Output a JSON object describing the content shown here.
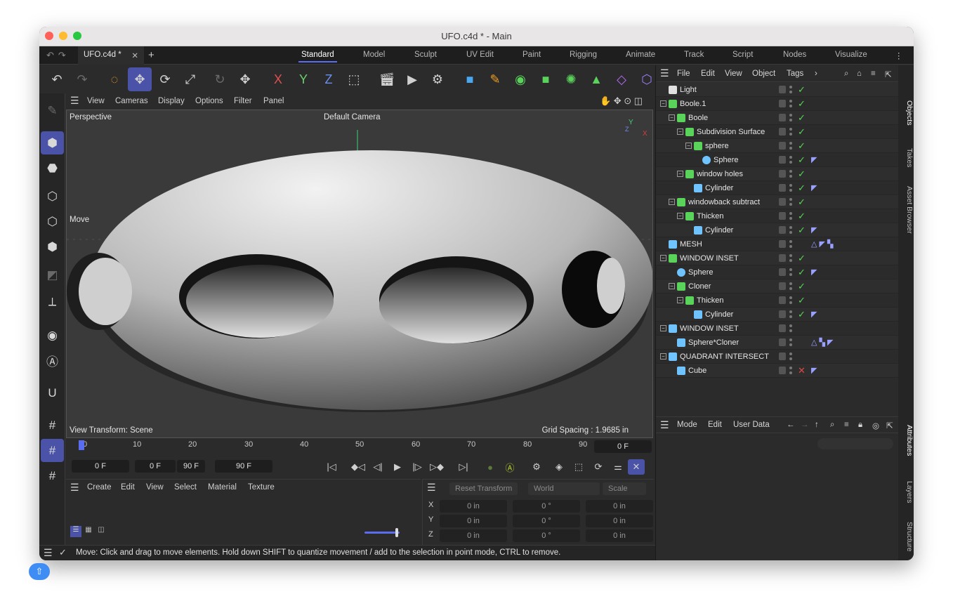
{
  "window": {
    "title": "UFO.c4d * - Main"
  },
  "doc_tab": {
    "label": "UFO.c4d *"
  },
  "layouts": [
    "Standard",
    "Model",
    "Sculpt",
    "UV Edit",
    "Paint",
    "Rigging",
    "Animate",
    "Track",
    "Script",
    "Nodes",
    "Visualize"
  ],
  "axes": {
    "x": "X",
    "y": "Y",
    "z": "Z"
  },
  "viewport_menu": [
    "View",
    "Cameras",
    "Display",
    "Options",
    "Filter",
    "Panel"
  ],
  "viewport": {
    "name": "Perspective",
    "camera": "Default Camera",
    "tool": "Move",
    "view_transform": "View Transform: Scene",
    "grid_spacing": "Grid Spacing : 1.9685 in"
  },
  "timeline": {
    "ticks": [
      "0",
      "10",
      "20",
      "30",
      "40",
      "50",
      "60",
      "70",
      "80",
      "90"
    ],
    "current_frame": "0 F",
    "start": "0 F",
    "min": "0 F",
    "max": "90 F",
    "end": "90 F"
  },
  "material_menu": [
    "Create",
    "Edit",
    "View",
    "Select",
    "Material",
    "Texture"
  ],
  "coords": {
    "reset": "Reset Transform",
    "space": "World",
    "mode": "Scale",
    "rows": [
      {
        "axis": "X",
        "pos": "0 in",
        "rot": "0 °",
        "scale": "0 in"
      },
      {
        "axis": "Y",
        "pos": "0 in",
        "rot": "0 °",
        "scale": "0 in"
      },
      {
        "axis": "Z",
        "pos": "0 in",
        "rot": "0 °",
        "scale": "0 in"
      }
    ]
  },
  "status": {
    "message": "Move: Click and drag to move elements. Hold down SHIFT to quantize movement / add to the selection in point mode, CTRL to remove."
  },
  "object_menu": [
    "File",
    "Edit",
    "View",
    "Object",
    "Tags"
  ],
  "objects": [
    {
      "name": "Light",
      "indent": 0,
      "icon": "light-icon",
      "color": "#e0e0e0",
      "check": "on",
      "tags": ""
    },
    {
      "name": "Boole.1",
      "indent": 0,
      "icon": "boole-icon",
      "color": "#5ad35a",
      "check": "on",
      "tags": ""
    },
    {
      "name": "Boole",
      "indent": 1,
      "icon": "boole-icon",
      "color": "#5ad35a",
      "check": "on",
      "tags": ""
    },
    {
      "name": "Subdivision Surface",
      "indent": 2,
      "icon": "subdivision-icon",
      "color": "#5ad35a",
      "check": "on",
      "tags": ""
    },
    {
      "name": "sphere",
      "indent": 3,
      "icon": "null-icon",
      "color": "#5ad35a",
      "check": "on",
      "tags": ""
    },
    {
      "name": "Sphere",
      "indent": 4,
      "icon": "sphere-icon",
      "color": "#6fc3ff",
      "check": "on",
      "tags": "◤"
    },
    {
      "name": "window holes",
      "indent": 2,
      "icon": "cloner-icon",
      "color": "#5ad35a",
      "check": "on",
      "tags": ""
    },
    {
      "name": "Cylinder",
      "indent": 3,
      "icon": "cylinder-icon",
      "color": "#6fc3ff",
      "check": "on",
      "tags": "◤"
    },
    {
      "name": "windowback subtract",
      "indent": 1,
      "icon": "cloner-icon",
      "color": "#5ad35a",
      "check": "on",
      "tags": ""
    },
    {
      "name": "Thicken",
      "indent": 2,
      "icon": "thicken-icon",
      "color": "#5ad35a",
      "check": "on",
      "tags": ""
    },
    {
      "name": "Cylinder",
      "indent": 3,
      "icon": "cylinder-icon",
      "color": "#6fc3ff",
      "check": "on",
      "tags": "◤"
    },
    {
      "name": "MESH",
      "indent": 0,
      "icon": "mesh-icon",
      "color": "#6fc3ff",
      "check": "dot",
      "tags": "△ ◤ ▚"
    },
    {
      "name": "WINDOW INSET",
      "indent": 0,
      "icon": "boole-icon",
      "color": "#5ad35a",
      "check": "on",
      "tags": ""
    },
    {
      "name": "Sphere",
      "indent": 1,
      "icon": "sphere-icon",
      "color": "#6fc3ff",
      "check": "on",
      "tags": "◤"
    },
    {
      "name": "Cloner",
      "indent": 1,
      "icon": "cloner-icon",
      "color": "#5ad35a",
      "check": "on",
      "tags": ""
    },
    {
      "name": "Thicken",
      "indent": 2,
      "icon": "thicken-icon",
      "color": "#5ad35a",
      "check": "on",
      "tags": ""
    },
    {
      "name": "Cylinder",
      "indent": 3,
      "icon": "cylinder-icon",
      "color": "#6fc3ff",
      "check": "on",
      "tags": "◤"
    },
    {
      "name": "WINDOW INSET",
      "indent": 0,
      "icon": "connect-icon",
      "color": "#6fc3ff",
      "check": "none",
      "tags": ""
    },
    {
      "name": "Sphere*Cloner",
      "indent": 1,
      "icon": "mesh-icon",
      "color": "#6fc3ff",
      "check": "none",
      "tags": "△ ▚ ◤"
    },
    {
      "name": "QUADRANT INTERSECT",
      "indent": 0,
      "icon": "connect-icon",
      "color": "#6fc3ff",
      "check": "none",
      "tags": ""
    },
    {
      "name": "Cube",
      "indent": 1,
      "icon": "cube-icon",
      "color": "#6fc3ff",
      "check": "off",
      "tags": "◤"
    }
  ],
  "attr_menu": [
    "Mode",
    "Edit",
    "User Data"
  ],
  "side_tabs": [
    "Objects",
    "Takes",
    "Asset Browser",
    "Attributes",
    "Layers",
    "Structure"
  ]
}
